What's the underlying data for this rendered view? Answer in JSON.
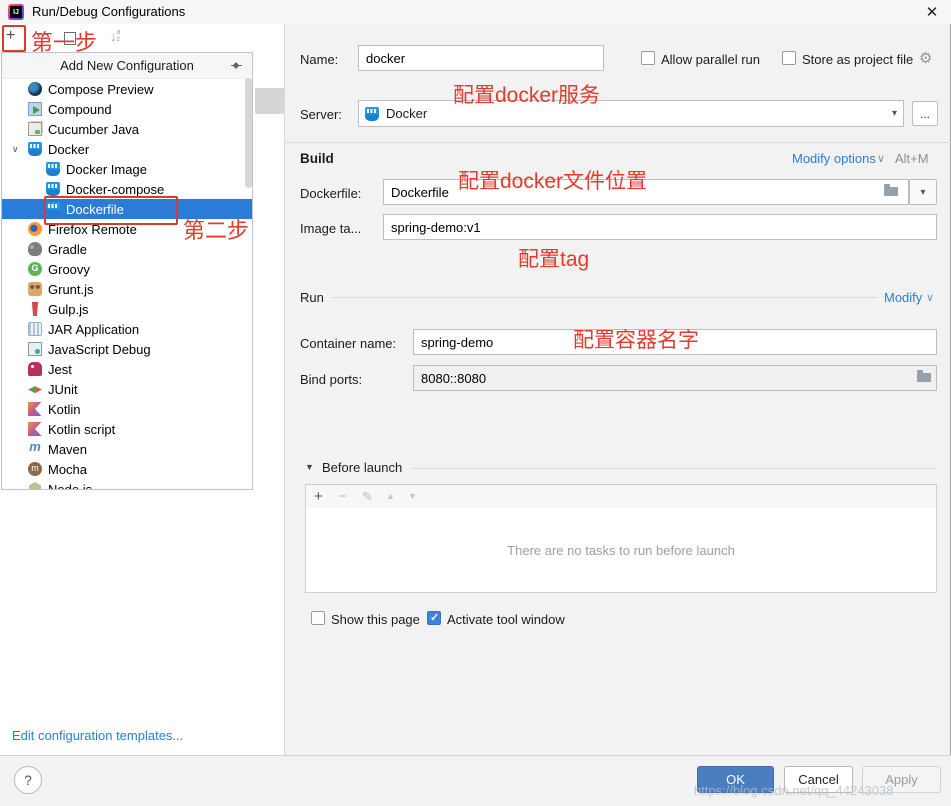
{
  "window": {
    "title": "Run/Debug Configurations",
    "app_badge": "IJ"
  },
  "icons": {
    "close": "✕",
    "plus": "+",
    "minus": "−",
    "arrow_down": "↓",
    "sort_a": "a",
    "sort_z": "z",
    "tree_chevron": "∨",
    "chevron_down": "∨",
    "dropdown": "▾",
    "before_chevron": "▾",
    "gear": "⚙",
    "pencil": "✎",
    "move_up": "▲",
    "move_down": "▼",
    "dots": "...",
    "help": "?"
  },
  "left": {
    "tree_header": "Add New Configuration",
    "edit_templates_link": "Edit configuration templates...",
    "tree_items": [
      {
        "label": "Compose Preview",
        "icon": "compose-preview",
        "indent": "0"
      },
      {
        "label": "Compound",
        "icon": "compound",
        "indent": "0"
      },
      {
        "label": "Cucumber Java",
        "icon": "cucumber",
        "indent": "0"
      },
      {
        "label": "Docker",
        "icon": "docker",
        "indent": "0",
        "chevron": "true"
      },
      {
        "label": "Docker Image",
        "icon": "docker",
        "indent": "1"
      },
      {
        "label": "Docker-compose",
        "icon": "docker",
        "indent": "1"
      },
      {
        "label": "Dockerfile",
        "icon": "docker",
        "indent": "1",
        "selected": "true"
      },
      {
        "label": "Firefox Remote",
        "icon": "firefox",
        "indent": "0"
      },
      {
        "label": "Gradle",
        "icon": "gradle",
        "indent": "0"
      },
      {
        "label": "Groovy",
        "icon": "groovy",
        "indent": "0"
      },
      {
        "label": "Grunt.js",
        "icon": "grunt",
        "indent": "0"
      },
      {
        "label": "Gulp.js",
        "icon": "gulp",
        "indent": "0"
      },
      {
        "label": "JAR Application",
        "icon": "jar",
        "indent": "0"
      },
      {
        "label": "JavaScript Debug",
        "icon": "jsdebug",
        "indent": "0"
      },
      {
        "label": "Jest",
        "icon": "jest",
        "indent": "0"
      },
      {
        "label": "JUnit",
        "icon": "junit",
        "indent": "0"
      },
      {
        "label": "Kotlin",
        "icon": "kotlin",
        "indent": "0"
      },
      {
        "label": "Kotlin script",
        "icon": "kotlin",
        "indent": "0"
      },
      {
        "label": "Maven",
        "icon": "maven",
        "indent": "0"
      },
      {
        "label": "Mocha",
        "icon": "mocha",
        "indent": "0"
      },
      {
        "label": "Node.js",
        "icon": "node",
        "indent": "0"
      }
    ]
  },
  "form": {
    "name_label": "Name:",
    "name_value": "docker",
    "allow_parallel_label": "Allow parallel run",
    "allow_parallel_checked": "false",
    "store_project_label": "Store as project file",
    "store_project_checked": "false",
    "server_label": "Server:",
    "server_value": "Docker",
    "build_title": "Build",
    "modify_options_label": "Modify options",
    "alt_m_shortcut": "Alt+M",
    "dockerfile_label": "Dockerfile:",
    "dockerfile_value": "Dockerfile",
    "image_tag_label": "Image ta...",
    "image_tag_value": "spring-demo:v1",
    "run_title": "Run",
    "modify_label": "Modify",
    "container_label": "Container name:",
    "container_value": "spring-demo",
    "bind_ports_label": "Bind ports:",
    "bind_ports_value": "8080::8080",
    "before_launch_title": "Before launch",
    "no_tasks_message": "There are no tasks to run before launch",
    "show_page_label": "Show this page",
    "show_page_checked": "false",
    "activate_tool_label": "Activate tool window",
    "activate_tool_checked": "true"
  },
  "buttons": {
    "ok": "OK",
    "cancel": "Cancel",
    "apply": "Apply"
  },
  "annotations": {
    "step1": "第一步",
    "step2": "第二步",
    "server_note": "配置docker服务",
    "dockerfile_note": "配置docker文件位置",
    "tag_note": "配置tag",
    "container_note": "配置容器名字",
    "watermark": "https://blog.csdn.net/qq_44243038"
  }
}
